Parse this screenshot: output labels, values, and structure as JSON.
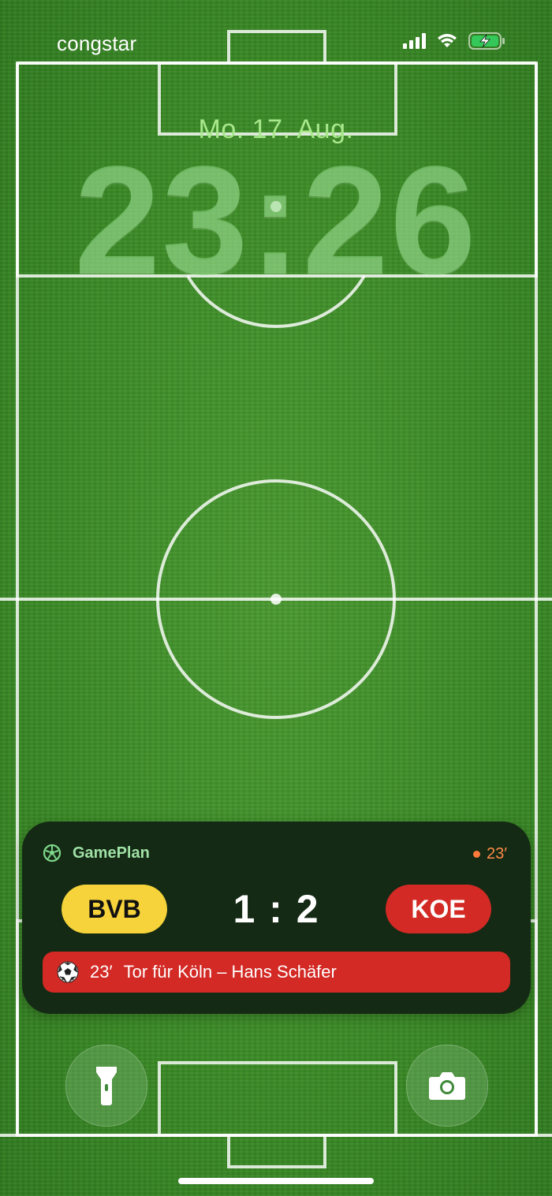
{
  "status_bar": {
    "carrier": "congstar",
    "signal": "signal-bars-icon",
    "wifi": "wifi-icon",
    "battery": "battery-charging-icon",
    "battery_color": "#34c759"
  },
  "lockscreen": {
    "date": "Mo. 17. Aug.",
    "time": "23:26"
  },
  "live_activity": {
    "app_name": "GamePlan",
    "app_icon": "soccer-ball-icon",
    "live_minute": "23′",
    "live_color": "#ff7a3a",
    "home_team": "BVB",
    "home_color": "#f6d33a",
    "score": "1 : 2",
    "away_team": "KOE",
    "away_color": "#d32a25",
    "event_minute": "23′",
    "event_text": "Tor für Köln – Hans Schäfer",
    "event_icon": "soccer-ball-icon"
  },
  "quick_actions": {
    "left": "flashlight-icon",
    "right": "camera-icon"
  }
}
